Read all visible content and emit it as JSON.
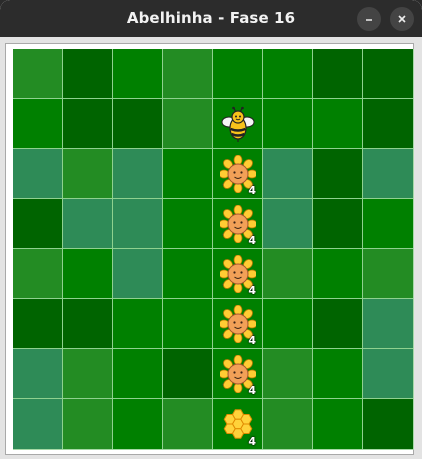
{
  "window": {
    "title": "Abelhinha - Fase 16",
    "buttons": {
      "minimize_icon": "minimize-icon",
      "close_icon": "close-icon"
    }
  },
  "colors": {
    "mid_green": "#238c23",
    "dark_green": "#006400",
    "bright_green": "#008000",
    "sea_green": "#2e8b57",
    "grid_line": "#8fd18f"
  },
  "board": {
    "rows": 8,
    "cols": 8,
    "tiles": [
      [
        "mid",
        "dark",
        "bright",
        "mid",
        "bright",
        "bright",
        "dark",
        "dark"
      ],
      [
        "bright",
        "dark",
        "dark",
        "mid",
        "bright",
        "bright",
        "bright",
        "dark"
      ],
      [
        "sea",
        "mid",
        "sea",
        "bright",
        "bright",
        "sea",
        "dark",
        "sea"
      ],
      [
        "dark",
        "sea",
        "sea",
        "bright",
        "bright",
        "sea",
        "dark",
        "bright"
      ],
      [
        "mid",
        "bright",
        "sea",
        "bright",
        "bright",
        "mid",
        "bright",
        "mid"
      ],
      [
        "dark",
        "dark",
        "bright",
        "bright",
        "bright",
        "bright",
        "dark",
        "sea"
      ],
      [
        "sea",
        "mid",
        "bright",
        "dark",
        "bright",
        "mid",
        "bright",
        "sea"
      ],
      [
        "sea",
        "mid",
        "bright",
        "mid",
        "bright",
        "mid",
        "bright",
        "dark"
      ]
    ],
    "pieces": [
      {
        "row": 1,
        "col": 4,
        "type": "bee",
        "icon": "bee-icon"
      },
      {
        "row": 2,
        "col": 4,
        "type": "flower",
        "icon": "flower-icon",
        "count": "4"
      },
      {
        "row": 3,
        "col": 4,
        "type": "flower",
        "icon": "flower-icon",
        "count": "4"
      },
      {
        "row": 4,
        "col": 4,
        "type": "flower",
        "icon": "flower-icon",
        "count": "4"
      },
      {
        "row": 5,
        "col": 4,
        "type": "flower",
        "icon": "flower-icon",
        "count": "4"
      },
      {
        "row": 6,
        "col": 4,
        "type": "flower",
        "icon": "flower-icon",
        "count": "4"
      },
      {
        "row": 7,
        "col": 4,
        "type": "honeycomb",
        "icon": "honeycomb-icon",
        "count": "4"
      }
    ]
  }
}
